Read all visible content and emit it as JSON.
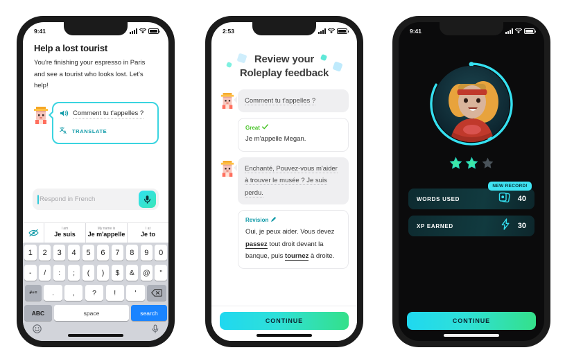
{
  "phone1": {
    "status": {
      "time": "9:41"
    },
    "lesson": {
      "title": "Help a lost tourist",
      "description": "You're finishing your espresso in Paris and see a tourist who looks lost. Let's help!"
    },
    "bubble": {
      "french_text": "Comment tu t'appelles ?",
      "translate_label": "TRANSLATE",
      "speaker_icon": "speaker-icon",
      "translate_icon": "translate-icon",
      "border_color": "#3ad4e0"
    },
    "input": {
      "placeholder": "Respond in French",
      "mic_icon": "microphone-icon"
    },
    "keyboard": {
      "suggestions": [
        {
          "en": "I am",
          "fr": "Je suis"
        },
        {
          "en": "My name is",
          "fr": "Je m'appelle"
        },
        {
          "en": "I at",
          "fr": "Je to"
        }
      ],
      "hide_icon": "hide-suggestions-icon",
      "row_numbers": [
        "1",
        "2",
        "3",
        "4",
        "5",
        "6",
        "7",
        "8",
        "9",
        "0"
      ],
      "row_symbols": [
        "-",
        "/",
        ":",
        ";",
        "(",
        ")",
        "$",
        "&",
        "@",
        "\""
      ],
      "row_punct": {
        "mode": "#+=",
        "keys": [
          ".",
          ",",
          "?",
          "!",
          "'"
        ],
        "delete_icon": "backspace-icon"
      },
      "row_bottom": {
        "abc": "ABC",
        "space": "space",
        "search": "search"
      },
      "bottom_bar": {
        "emoji_icon": "emoji-icon",
        "dictation_icon": "dictation-icon"
      }
    }
  },
  "phone2": {
    "status": {
      "time": "2:53"
    },
    "header": {
      "line1": "Review your",
      "line2": "Roleplay feedback"
    },
    "messages": [
      {
        "type": "npc",
        "text": "Comment tu t'appelles ?"
      },
      {
        "type": "user",
        "tag": "Great",
        "tag_icon": "check-icon",
        "text": "Je m'appelle Megan."
      },
      {
        "type": "npc",
        "text": "Enchanté, Pouvez-vous m'aider à trouver le musée ? Je suis perdu."
      },
      {
        "type": "revision",
        "tag": "Revision",
        "tag_icon": "pencil-icon",
        "parts": [
          {
            "text": "Oui, je peux aider. Vous devez ",
            "bold": false
          },
          {
            "text": "passez",
            "bold": true
          },
          {
            "text": " tout droit devant la banque, puis ",
            "bold": false
          },
          {
            "text": "tournez",
            "bold": true
          },
          {
            "text": " à droite.",
            "bold": false
          }
        ]
      }
    ],
    "cta": {
      "label": "CONTINUE"
    },
    "sparkle_colors": [
      "#7ef0e0",
      "#cfeefc",
      "#5fe8d8",
      "#bfeafc"
    ]
  },
  "phone3": {
    "status": {
      "time": "9:41"
    },
    "avatar": {
      "name": "character-portrait",
      "ring_color": "#35e0f0"
    },
    "stars": {
      "filled": 2,
      "total": 3,
      "filled_color": "#3de8a8",
      "empty_color": "#4a535a"
    },
    "stats": [
      {
        "label": "WORDS USED",
        "value": "40",
        "icon": "word-cards-icon",
        "badge": "NEW RECORD!"
      },
      {
        "label": "XP EARNED",
        "value": "30",
        "icon": "xp-bolt-icon",
        "badge": null
      }
    ],
    "cta": {
      "label": "CONTINUE"
    }
  }
}
